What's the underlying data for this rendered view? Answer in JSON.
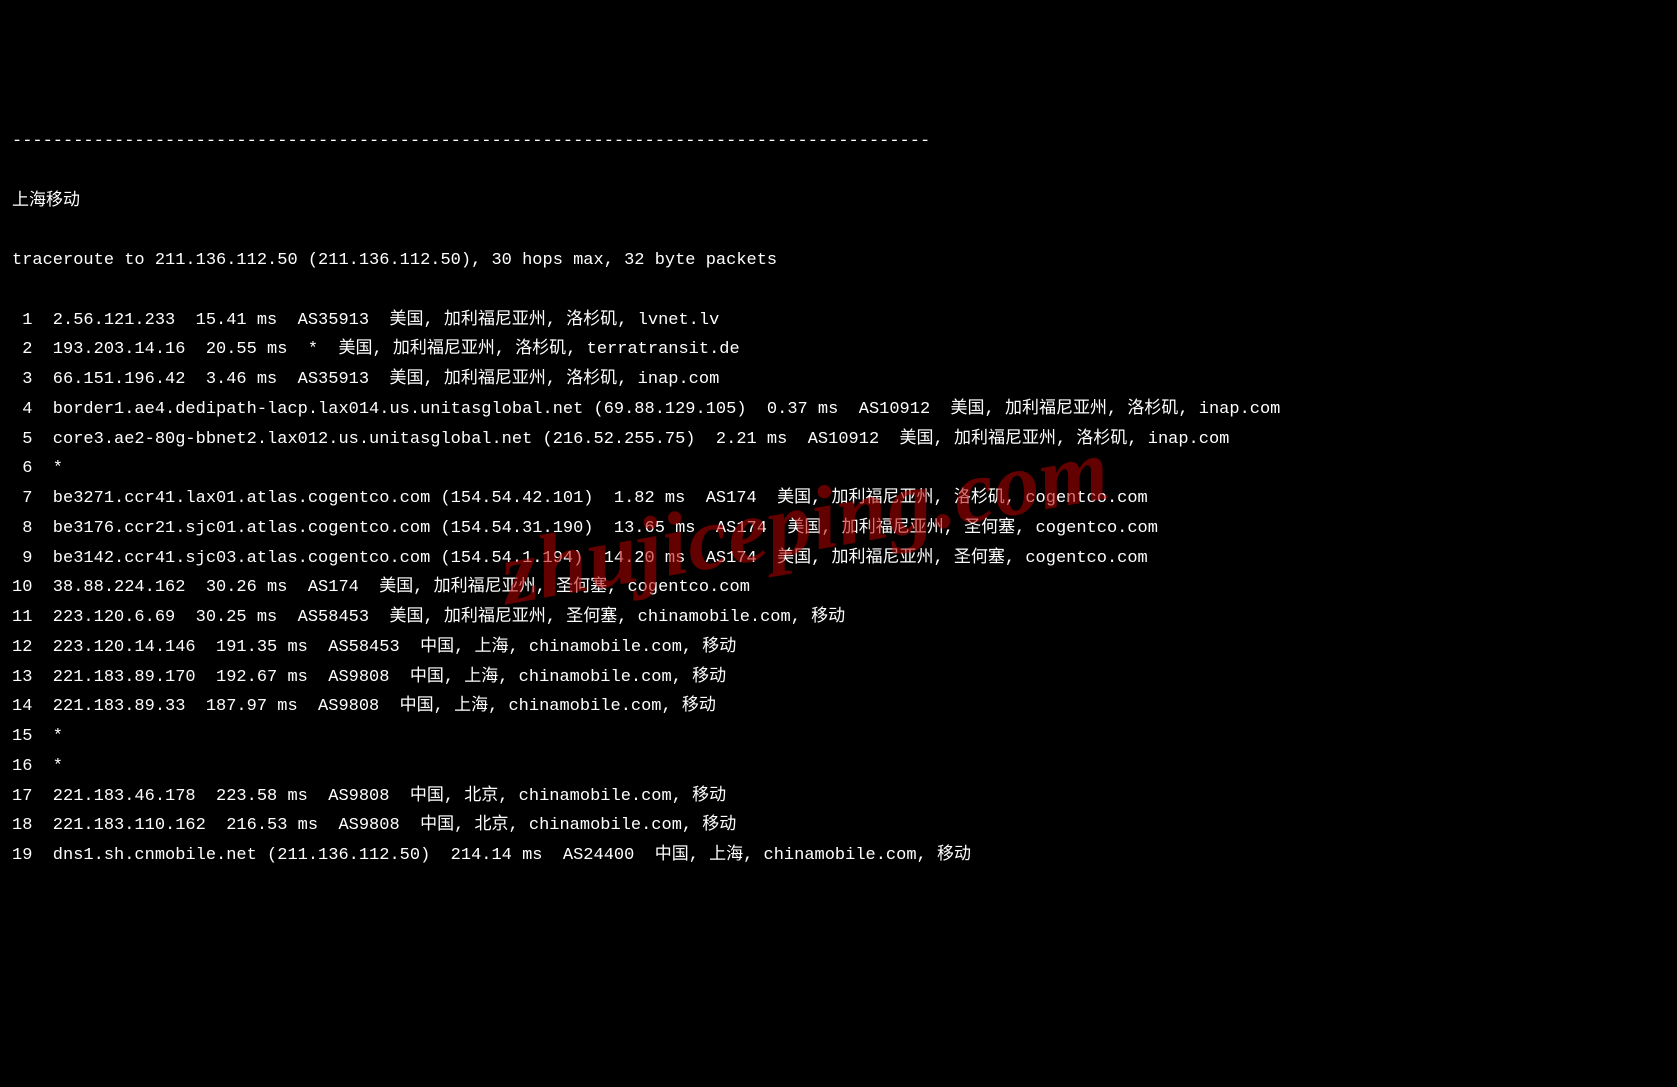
{
  "divider": "------------------------------------------------------------------------------------------",
  "title": "上海移动",
  "header": "traceroute to 211.136.112.50 (211.136.112.50), 30 hops max, 32 byte packets",
  "watermark": "zhujiceping.com",
  "hops": [
    {
      "num": " 1",
      "text": "2.56.121.233  15.41 ms  AS35913  美国, 加利福尼亚州, 洛杉矶, lvnet.lv"
    },
    {
      "num": " 2",
      "text": "193.203.14.16  20.55 ms  *  美国, 加利福尼亚州, 洛杉矶, terratransit.de"
    },
    {
      "num": " 3",
      "text": "66.151.196.42  3.46 ms  AS35913  美国, 加利福尼亚州, 洛杉矶, inap.com"
    },
    {
      "num": " 4",
      "text": "border1.ae4.dedipath-lacp.lax014.us.unitasglobal.net (69.88.129.105)  0.37 ms  AS10912  美国, 加利福尼亚州, 洛杉矶, inap.com"
    },
    {
      "num": " 5",
      "text": "core3.ae2-80g-bbnet2.lax012.us.unitasglobal.net (216.52.255.75)  2.21 ms  AS10912  美国, 加利福尼亚州, 洛杉矶, inap.com"
    },
    {
      "num": " 6",
      "text": "*"
    },
    {
      "num": " 7",
      "text": "be3271.ccr41.lax01.atlas.cogentco.com (154.54.42.101)  1.82 ms  AS174  美国, 加利福尼亚州, 洛杉矶, cogentco.com"
    },
    {
      "num": " 8",
      "text": "be3176.ccr21.sjc01.atlas.cogentco.com (154.54.31.190)  13.65 ms  AS174  美国, 加利福尼亚州, 圣何塞, cogentco.com"
    },
    {
      "num": " 9",
      "text": "be3142.ccr41.sjc03.atlas.cogentco.com (154.54.1.194)  14.20 ms  AS174  美国, 加利福尼亚州, 圣何塞, cogentco.com"
    },
    {
      "num": "10",
      "text": "38.88.224.162  30.26 ms  AS174  美国, 加利福尼亚州, 圣何塞, cogentco.com"
    },
    {
      "num": "11",
      "text": "223.120.6.69  30.25 ms  AS58453  美国, 加利福尼亚州, 圣何塞, chinamobile.com, 移动"
    },
    {
      "num": "12",
      "text": "223.120.14.146  191.35 ms  AS58453  中国, 上海, chinamobile.com, 移动"
    },
    {
      "num": "13",
      "text": "221.183.89.170  192.67 ms  AS9808  中国, 上海, chinamobile.com, 移动"
    },
    {
      "num": "14",
      "text": "221.183.89.33  187.97 ms  AS9808  中国, 上海, chinamobile.com, 移动"
    },
    {
      "num": "15",
      "text": "*"
    },
    {
      "num": "16",
      "text": "*"
    },
    {
      "num": "17",
      "text": "221.183.46.178  223.58 ms  AS9808  中国, 北京, chinamobile.com, 移动"
    },
    {
      "num": "18",
      "text": "221.183.110.162  216.53 ms  AS9808  中国, 北京, chinamobile.com, 移动"
    },
    {
      "num": "19",
      "text": "dns1.sh.cnmobile.net (211.136.112.50)  214.14 ms  AS24400  中国, 上海, chinamobile.com, 移动"
    }
  ]
}
